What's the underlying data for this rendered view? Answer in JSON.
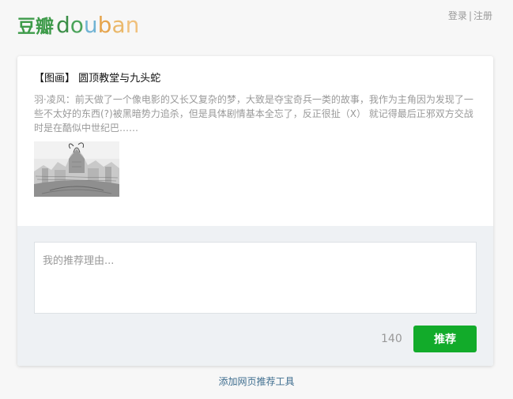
{
  "header": {
    "logo_cn": "豆瓣",
    "logo_en_letters": [
      "d",
      "o",
      "u",
      "b",
      "a",
      "n"
    ],
    "login": "登录",
    "separator": "|",
    "register": "注册"
  },
  "share": {
    "title": "【图画】 圆顶教堂与九头蛇",
    "description": "羽·凌风：前天做了一个像电影的又长又复杂的梦，大致是夺宝奇兵一类的故事，我作为主角因为发现了一些不太好的东西(?)被黑暗势力追杀，但是具体剧情基本全忘了，反正很扯（X） 就记得最后正邪双方交战时是在酷似中世纪巴……"
  },
  "form": {
    "reason_placeholder": "我的推荐理由...",
    "counter": "140",
    "submit_label": "推荐"
  },
  "footer": {
    "tool_link": "添加网页推荐工具"
  },
  "colors": {
    "brand_green": "#3e9b4a",
    "button_green": "#12ab2a",
    "link_blue": "#3f6e8f"
  }
}
